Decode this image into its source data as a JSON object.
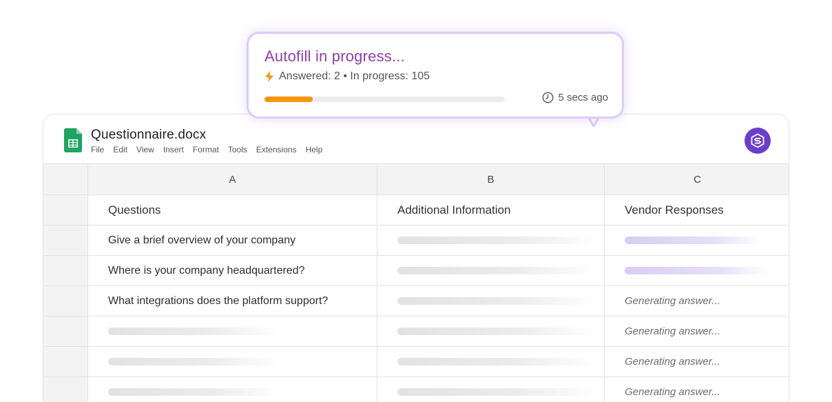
{
  "document": {
    "title": "Questionnaire.docx",
    "menu": [
      "File",
      "Edit",
      "View",
      "Insert",
      "Format",
      "Tools",
      "Extensions",
      "Help"
    ]
  },
  "popover": {
    "title": "Autofill in progress...",
    "status": "Answered: 2 • In progress: 105",
    "progress_fraction": 0.2,
    "time": "5 secs ago",
    "accent": "#8f3fa8",
    "progress_color": "#f6960e"
  },
  "sheet": {
    "column_letters": [
      "A",
      "B",
      "C"
    ],
    "headers": [
      "Questions",
      "Additional Information",
      "Vendor Responses"
    ],
    "rows": [
      {
        "question": "Give a brief overview of your company",
        "response_state": "filled",
        "response": ""
      },
      {
        "question": "Where is your company headquartered?",
        "response_state": "filled",
        "response": ""
      },
      {
        "question": "What integrations does the platform support?",
        "response_state": "generating",
        "response": "Generating answer..."
      },
      {
        "question": "",
        "response_state": "generating",
        "response": "Generating answer..."
      },
      {
        "question": "",
        "response_state": "generating",
        "response": "Generating answer..."
      },
      {
        "question": "",
        "response_state": "generating",
        "response": "Generating answer..."
      }
    ]
  },
  "icons": {
    "file": "google-sheets-icon",
    "brand": "brand-logo-icon",
    "bolt": "bolt-icon",
    "clock": "clock-icon"
  },
  "colors": {
    "brand": "#6b3fc9",
    "sheets_green": "#1fa463"
  }
}
